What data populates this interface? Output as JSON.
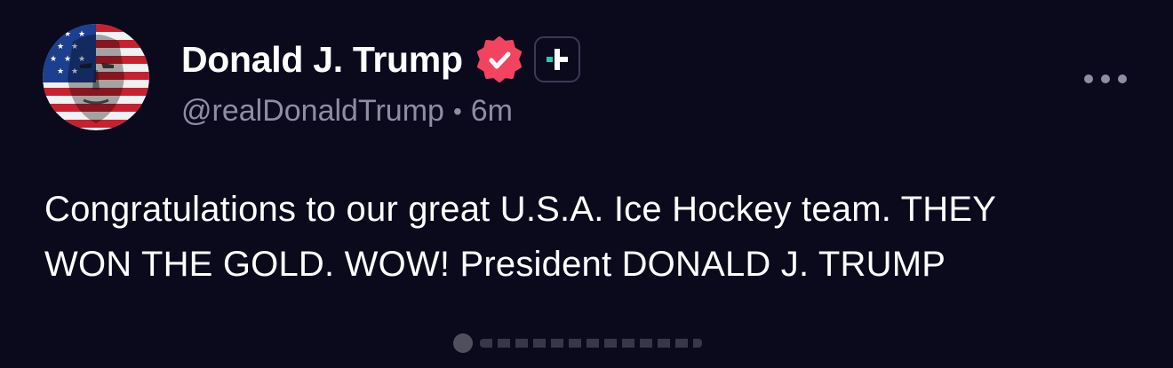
{
  "author": {
    "display_name": "Donald J. Trump",
    "handle": "@realDonaldTrump",
    "separator": "•",
    "time_ago": "6m",
    "verified_icon": "verified-badge-icon",
    "follow_icon": "plus-icon"
  },
  "post": {
    "text": "Congratulations to our great U.S.A. Ice Hockey team. THEY WON THE GOLD. WOW! President DONALD J. TRUMP"
  },
  "menu": {
    "icon": "more-options-icon"
  },
  "colors": {
    "background": "#0b0a1c",
    "verified_badge": "#f2445f",
    "follow_accent": "#27c7b0",
    "secondary_text": "#8e8da4"
  }
}
